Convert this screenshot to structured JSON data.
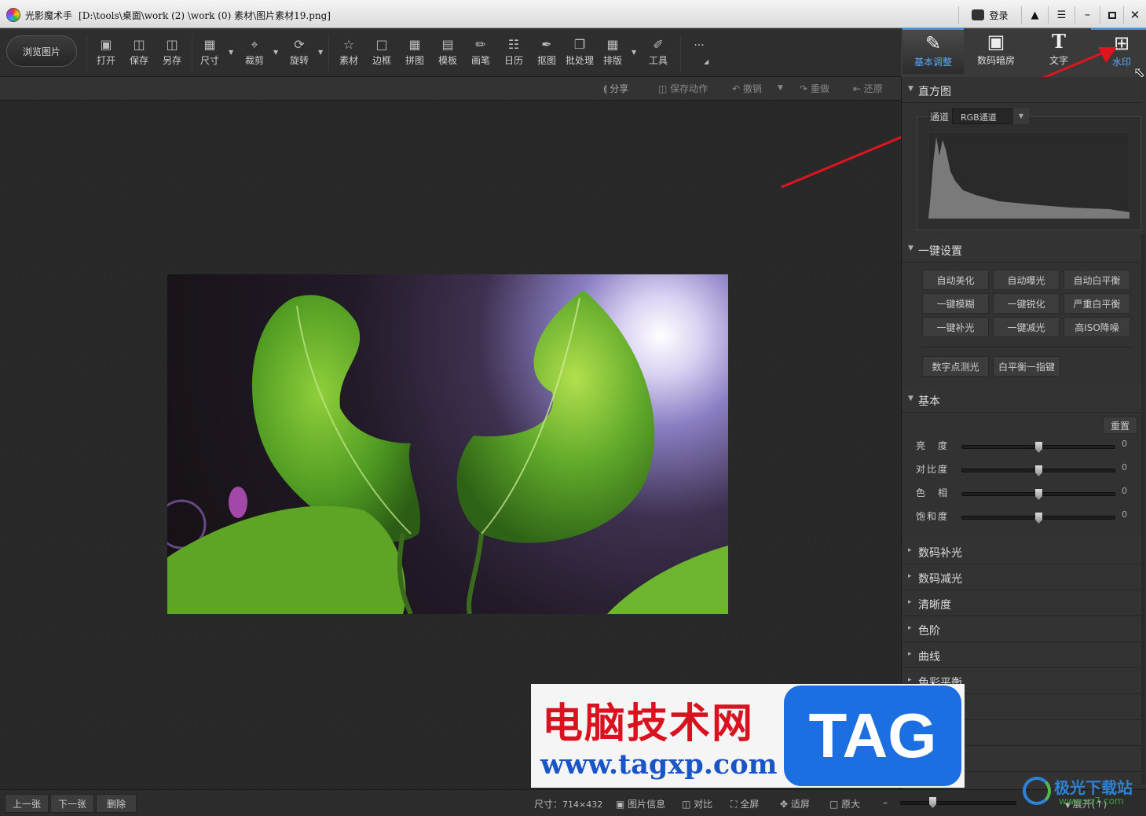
{
  "titlebar": {
    "app_name": "光影魔术手",
    "file_path": "[D:\\tools\\桌面\\work (2) \\work (0) 素材\\图片素材19.png]",
    "login": "登录"
  },
  "toolbar": {
    "browse": "浏览图片",
    "tools": [
      {
        "label": "打开",
        "icon": "open-icon"
      },
      {
        "label": "保存",
        "icon": "save-icon"
      },
      {
        "label": "另存",
        "icon": "save-as-icon"
      },
      {
        "label": "尺寸",
        "icon": "resize-icon"
      },
      {
        "label": "裁剪",
        "icon": "crop-icon"
      },
      {
        "label": "旋转",
        "icon": "rotate-icon"
      },
      {
        "label": "素材",
        "icon": "material-icon"
      },
      {
        "label": "边框",
        "icon": "border-icon"
      },
      {
        "label": "拼图",
        "icon": "collage-icon"
      },
      {
        "label": "模板",
        "icon": "template-icon"
      },
      {
        "label": "画笔",
        "icon": "brush-icon"
      },
      {
        "label": "日历",
        "icon": "calendar-icon"
      },
      {
        "label": "抠图",
        "icon": "cutout-icon"
      },
      {
        "label": "批处理",
        "icon": "batch-icon"
      },
      {
        "label": "排版",
        "icon": "layout-icon"
      },
      {
        "label": "工具",
        "icon": "wrench-icon"
      }
    ],
    "more": "···"
  },
  "subbar": {
    "share": "分享",
    "save_action": "保存动作",
    "undo": "撤销",
    "redo": "重做",
    "restore": "还原"
  },
  "right_tabs": [
    {
      "label": "基本调整",
      "icon": "edit-icon"
    },
    {
      "label": "数码暗房",
      "icon": "darkroom-icon"
    },
    {
      "label": "文字",
      "icon": "text-icon"
    },
    {
      "label": "水印",
      "icon": "watermark-icon"
    }
  ],
  "panel": {
    "histogram": {
      "title": "直方图",
      "channel_label": "通道",
      "channel_value": "RGB通道"
    },
    "oneclick": {
      "title": "一键设置",
      "buttons": [
        "自动美化",
        "自动曝光",
        "自动白平衡",
        "一键模糊",
        "一键锐化",
        "严重白平衡",
        "一键补光",
        "一键减光",
        "高ISO降噪"
      ],
      "extra": [
        "数字点测光",
        "白平衡一指键"
      ]
    },
    "basic": {
      "title": "基本",
      "reset": "重置",
      "sliders": [
        {
          "label": "亮　度",
          "value": "0"
        },
        {
          "label": "对比度",
          "value": "0"
        },
        {
          "label": "色　相",
          "value": "0"
        },
        {
          "label": "饱和度",
          "value": "0"
        }
      ]
    },
    "collapsed": [
      "数码补光",
      "数码减光",
      "清晰度",
      "色阶",
      "曲线",
      "色彩平衡"
    ]
  },
  "statusbar": {
    "prev": "上一张",
    "next": "下一张",
    "delete": "删除",
    "size_label": "尺寸：",
    "size_value": "714×432",
    "info": "图片信息",
    "compare": "对比",
    "fullscreen": "全屏",
    "fit": "适屏",
    "original": "原大",
    "expand": "展开(↑)",
    "zoom_level": 0.26
  },
  "overlays": {
    "site_name": "电脑技术网",
    "site_url": "www.tagxp.com",
    "tag": "TAG",
    "site2_name": "极光下载站",
    "site2_url": "www.xz7.com"
  }
}
